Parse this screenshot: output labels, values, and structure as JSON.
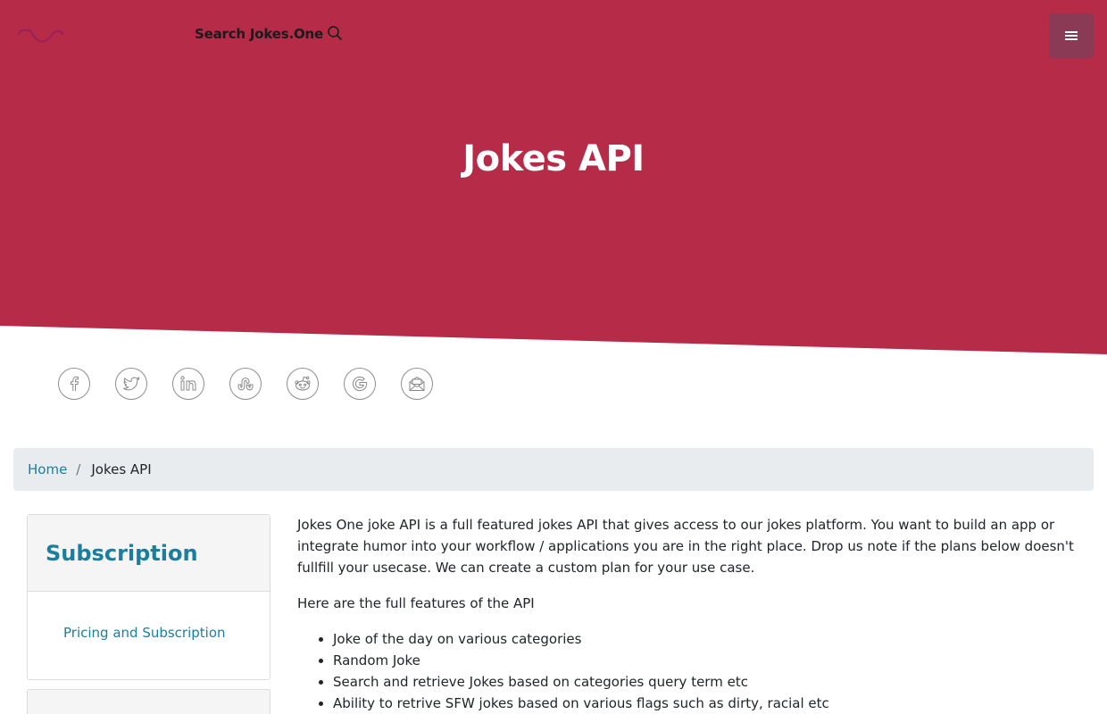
{
  "header": {
    "search_label": "Search Jokes.One",
    "brand_color": "#b52b48",
    "menu_button_color": "#8a3a55"
  },
  "hero": {
    "title": "Jokes API"
  },
  "share": {
    "icons": [
      "facebook-icon",
      "twitter-icon",
      "linkedin-icon",
      "stumbleupon-icon",
      "reddit-icon",
      "google-icon",
      "email-icon"
    ]
  },
  "breadcrumb": {
    "home": "Home",
    "separator": "/",
    "current": "Jokes API"
  },
  "sidebar": {
    "title": "Subscription",
    "link": "Pricing and Subscription"
  },
  "main": {
    "intro": "Jokes One joke API is a full featured jokes API that gives access to our jokes platform. You want to build an app or integrate humor into your workflow / applications you are in the right place. Drop us note if the plans below doesn't fullfill your usecase. We can create a custom plan for your use case.",
    "features_heading": "Here are the full features of the API",
    "features": [
      "Joke of the day on various categories",
      "Random Joke",
      "Search and retrieve Jokes based on categories query term etc",
      "Ability to retrive SFW jokes based on various flags such as dirty, racial etc"
    ]
  }
}
